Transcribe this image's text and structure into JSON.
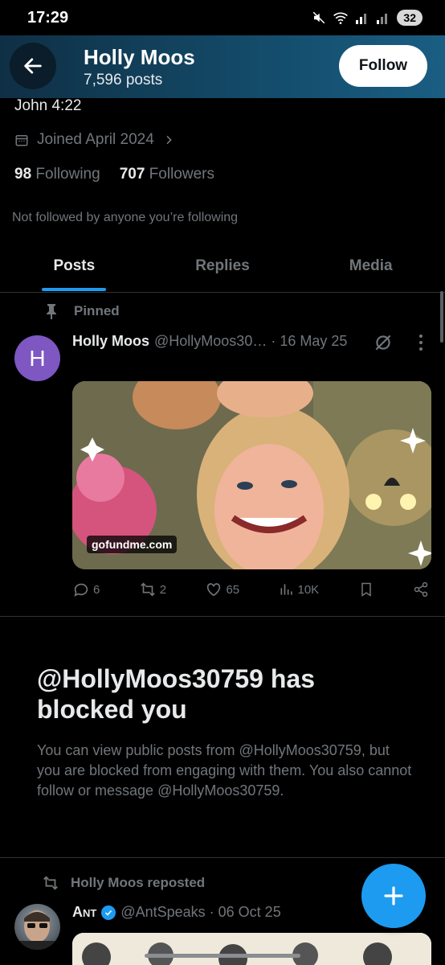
{
  "status_bar": {
    "time": "17:29",
    "battery": "32"
  },
  "header": {
    "name": "Holly Moos",
    "posts_count": "7,596 posts",
    "follow_label": "Follow"
  },
  "profile": {
    "bio_tail": "John 4:22",
    "joined": "Joined April 2024",
    "following_count": "98",
    "following_label": "Following",
    "followers_count": "707",
    "followers_label": "Followers",
    "not_followed": "Not followed by anyone you’re following"
  },
  "tabs": [
    {
      "label": "Posts",
      "active": true
    },
    {
      "label": "Replies",
      "active": false
    },
    {
      "label": "Media",
      "active": false
    }
  ],
  "pinned_post": {
    "pinned_label": "Pinned",
    "avatar_letter": "H",
    "author_name": "Holly Moos",
    "author_meta": "@HollyMoos30… · 16 May 25",
    "link_badge": "gofundme.com",
    "replies": "6",
    "reposts": "2",
    "likes": "65",
    "views": "10K"
  },
  "blocked": {
    "title": "@HollyMoos30759 has blocked you",
    "body": "You can view public posts from @HollyMoos30759, but you are blocked from engaging with them. You also cannot follow or message @HollyMoos30759."
  },
  "repost": {
    "label": "Holly Moos reposted",
    "author_name": "Ant",
    "author_meta": "@AntSpeaks · 06 Oct 25"
  },
  "colors": {
    "accent": "#1d9bf0",
    "header_start": "#0f2f45",
    "header_end": "#1a5e83",
    "avatar_purple": "#7e57c2"
  }
}
